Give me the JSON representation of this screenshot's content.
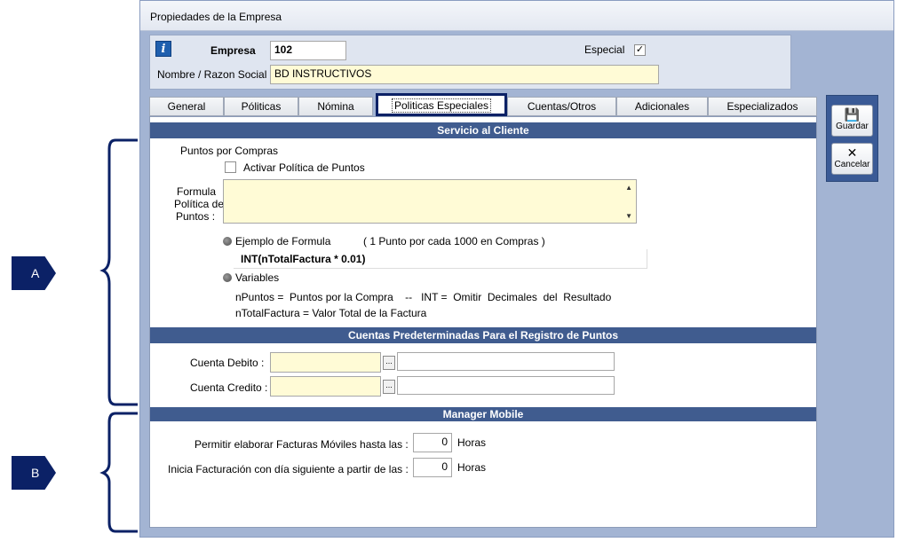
{
  "window": {
    "title": "Propiedades de la Empresa"
  },
  "header": {
    "empresa_label": "Empresa",
    "empresa_value": "102",
    "especial_label": "Especial",
    "especial_checked": "✓",
    "razon_label": "Nombre / Razon Social",
    "razon_value": "BD INSTRUCTIVOS"
  },
  "tabs": [
    {
      "label": "General"
    },
    {
      "label": "Póliticas"
    },
    {
      "label": "Nómina"
    },
    {
      "label": "Politicas Especiales"
    },
    {
      "label": "Cuentas/Otros"
    },
    {
      "label": "Adicionales"
    },
    {
      "label": "Especializados"
    }
  ],
  "servicio": {
    "title": "Servicio al  Cliente",
    "puntos_label": "Puntos por Compras",
    "activar_label": "Activar  Política  de  Puntos",
    "formula_label_1": "Formula",
    "formula_label_2": "Política de",
    "formula_label_3": "Puntos :",
    "ejemplo_label": "Ejemplo de Formula",
    "ejemplo_note": "( 1  Punto por cada  1000  en  Compras )",
    "ejemplo_formula": "INT(nTotalFactura  *  0.01)",
    "variables_label": "Variables",
    "var_line_1": "nPuntos =  Puntos por la Compra    --   INT =  Omitir  Decimales  del  Resultado",
    "var_line_2": "nTotalFactura =  Valor Total de la Factura"
  },
  "cuentas": {
    "title": "Cuentas  Predeterminadas  Para  el  Registro  de  Puntos",
    "debito_label": "Cuenta Debito  :",
    "credito_label": "Cuenta Credito  :",
    "ellipsis": "..."
  },
  "mobile": {
    "title": "Manager Mobile",
    "permitir_label": "Permitir elaborar Facturas Móviles hasta las :",
    "permitir_value": "0",
    "inicia_label": "Inicia Facturación con día siguiente a partir de las :",
    "inicia_value": "0",
    "horas_label": "Horas"
  },
  "sidebar": {
    "guardar_label": "Guardar",
    "cancelar_label": "Cancelar"
  },
  "annotations": {
    "a": "A",
    "b": "B"
  },
  "colors": {
    "section_bar": "#405c8f",
    "callout": "#0b2166",
    "window_bg": "#a3b4d3",
    "field_yellow": "#fffbd6"
  }
}
